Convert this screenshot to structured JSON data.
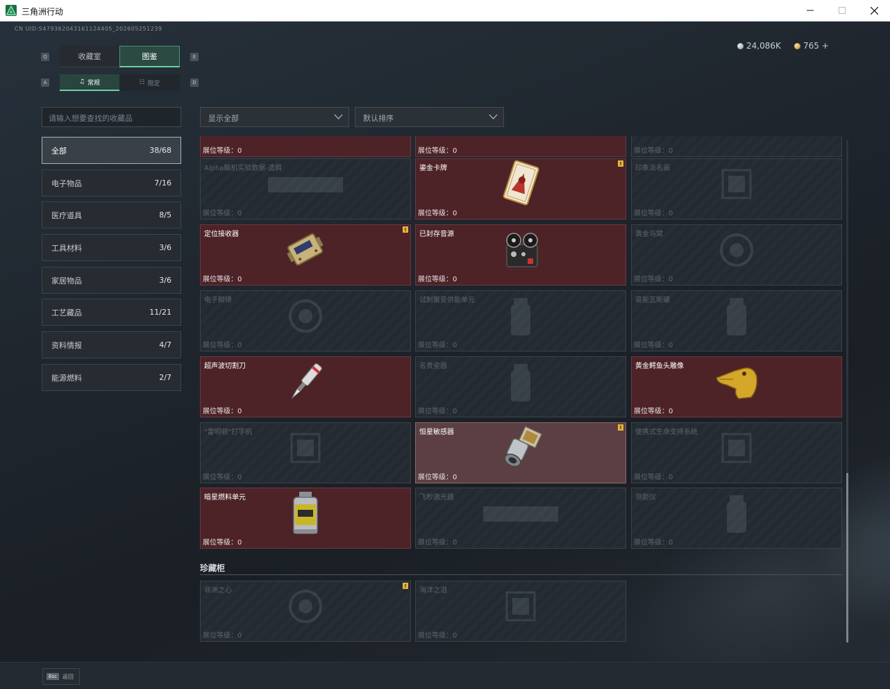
{
  "window": {
    "title": "三角洲行动"
  },
  "header": {
    "uid": "CN UID:5479362043161124405_202605251239",
    "currency_a": "24,086K",
    "currency_b": "765 +"
  },
  "tabs": {
    "key_left": "Q",
    "key_right": "E",
    "main": [
      {
        "label": "收藏室"
      },
      {
        "label": "图鉴"
      }
    ],
    "sub_key_left": "A",
    "sub_key_right": "D",
    "sub": [
      {
        "label": "常规"
      },
      {
        "label": "限定"
      }
    ]
  },
  "search": {
    "placeholder": "请输入想要查找的收藏品"
  },
  "categories": [
    {
      "label": "全部",
      "count": "38/68"
    },
    {
      "label": "电子物品",
      "count": "7/16"
    },
    {
      "label": "医疗道具",
      "count": "8/5"
    },
    {
      "label": "工具材料",
      "count": "3/6"
    },
    {
      "label": "家居物品",
      "count": "3/6"
    },
    {
      "label": "工艺藏品",
      "count": "11/21"
    },
    {
      "label": "资料情报",
      "count": "4/7"
    },
    {
      "label": "能源燃料",
      "count": "2/7"
    }
  ],
  "filters": {
    "display": "显示全部",
    "sort": "默认排序"
  },
  "level_label": "展位等级：0",
  "cards": [
    {
      "name": "",
      "state": "owned"
    },
    {
      "name": "",
      "state": "owned"
    },
    {
      "name": "",
      "state": "locked"
    },
    {
      "name": "Alpha脑机实验数据-遗羁",
      "state": "locked"
    },
    {
      "name": "鎏金卡牌",
      "state": "owned",
      "badge": "!"
    },
    {
      "name": "印象派名画",
      "state": "locked"
    },
    {
      "name": "定位接收器",
      "state": "owned",
      "badge": "!"
    },
    {
      "name": "已封存音源",
      "state": "owned"
    },
    {
      "name": "黄金鸟窝",
      "state": "locked"
    },
    {
      "name": "电子脚镣",
      "state": "locked"
    },
    {
      "name": "试制聚变供能单元",
      "state": "locked"
    },
    {
      "name": "高能瓦斯罐",
      "state": "locked"
    },
    {
      "name": "超声波切割刀",
      "state": "owned"
    },
    {
      "name": "名贵瓷器",
      "state": "locked"
    },
    {
      "name": "黄金鳄鱼头雕像",
      "state": "owned"
    },
    {
      "name": "\"雷明顿\"打字机",
      "state": "locked"
    },
    {
      "name": "恒星敏感器",
      "state": "highlight",
      "badge": "!"
    },
    {
      "name": "便携式生命支持系统",
      "state": "locked"
    },
    {
      "name": "暗星燃料单元",
      "state": "owned"
    },
    {
      "name": "飞秒激光器",
      "state": "locked"
    },
    {
      "name": "测距仪",
      "state": "locked"
    }
  ],
  "cabinet": {
    "title": "珍藏柜",
    "cards": [
      {
        "name": "非洲之心",
        "state": "locked",
        "badge": "!"
      },
      {
        "name": "海洋之泪",
        "state": "locked"
      }
    ]
  },
  "footer": {
    "esc": "Esc",
    "back": "返回"
  },
  "colors": {
    "accent": "#6ad1a6",
    "owned_bg": "#4d2328",
    "badge": "#e8b43c"
  }
}
